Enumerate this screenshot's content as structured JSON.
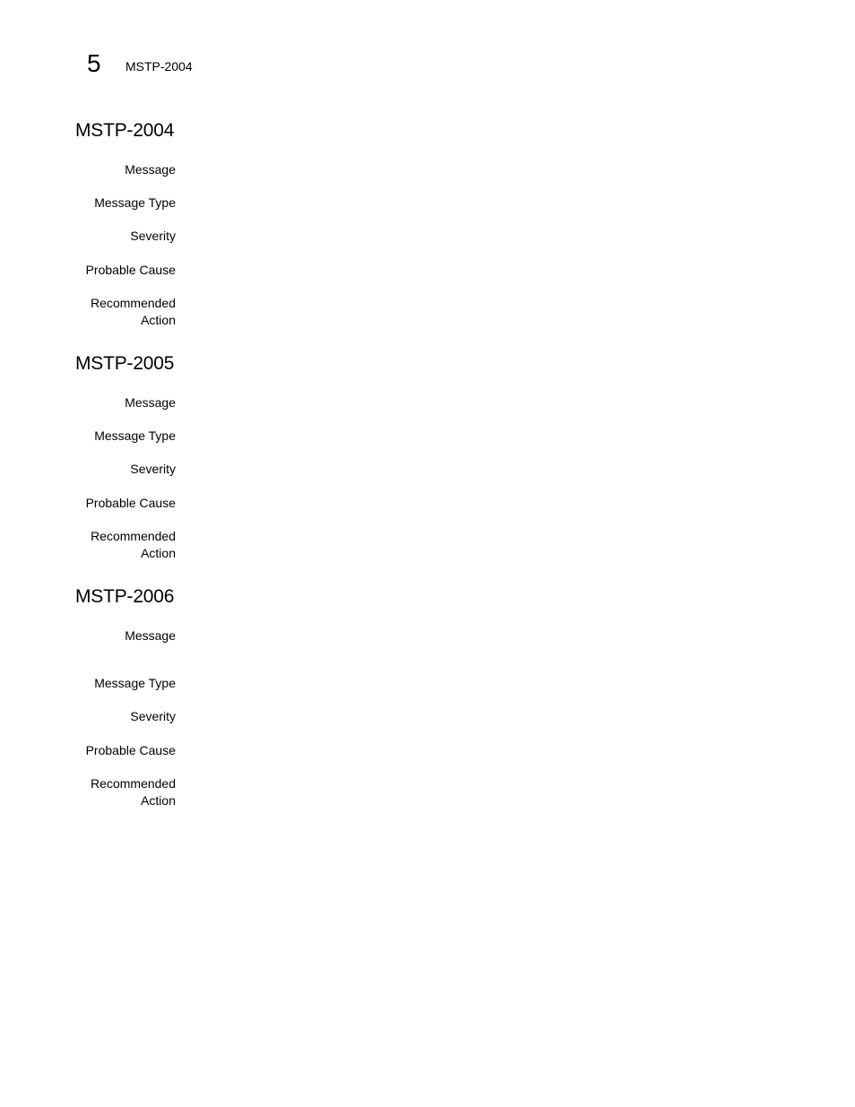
{
  "header": {
    "chapter_number": "5",
    "running_title": "MSTP-2004"
  },
  "sections": [
    {
      "title": "MSTP-2004",
      "fields": {
        "message": {
          "label": "Message",
          "value": ""
        },
        "message_type": {
          "label": "Message Type",
          "value": ""
        },
        "severity": {
          "label": "Severity",
          "value": ""
        },
        "probable_cause": {
          "label": "Probable Cause",
          "value": ""
        },
        "recommended_action": {
          "label_line1": "Recommended",
          "label_line2": "Action",
          "value": ""
        }
      }
    },
    {
      "title": "MSTP-2005",
      "fields": {
        "message": {
          "label": "Message",
          "value": ""
        },
        "message_type": {
          "label": "Message Type",
          "value": ""
        },
        "severity": {
          "label": "Severity",
          "value": ""
        },
        "probable_cause": {
          "label": "Probable Cause",
          "value": ""
        },
        "recommended_action": {
          "label_line1": "Recommended",
          "label_line2": "Action",
          "value": ""
        }
      }
    },
    {
      "title": "MSTP-2006",
      "fields": {
        "message": {
          "label": "Message",
          "value": ""
        },
        "message_type": {
          "label": "Message Type",
          "value": ""
        },
        "severity": {
          "label": "Severity",
          "value": ""
        },
        "probable_cause": {
          "label": "Probable Cause",
          "value": ""
        },
        "recommended_action": {
          "label_line1": "Recommended",
          "label_line2": "Action",
          "value": ""
        }
      }
    }
  ]
}
